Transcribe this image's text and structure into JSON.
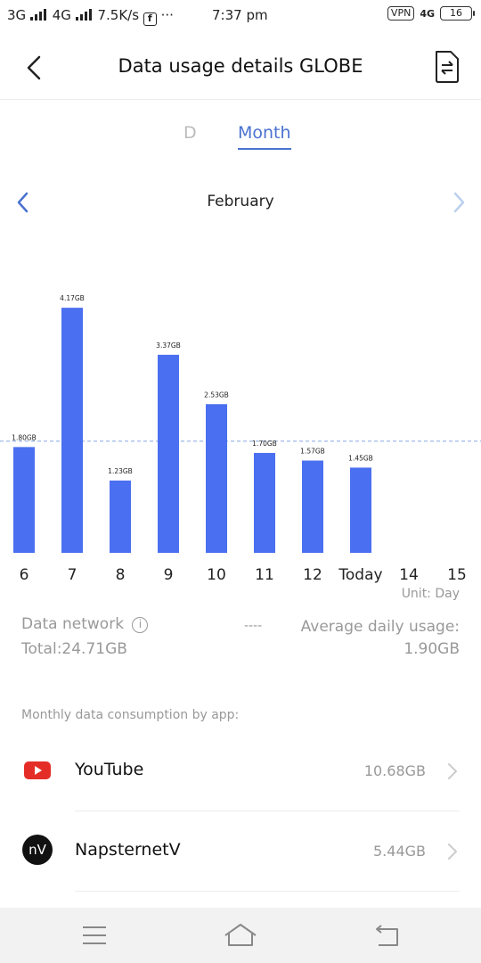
{
  "status_bar": {
    "left_text": "3G",
    "left_text2": "4G",
    "speed": "7.5K/s",
    "dots": "···",
    "time": "7:37 pm",
    "vpn": "VPN",
    "net": "4G",
    "battery": "16"
  },
  "header": {
    "title": "Data usage details GLOBE",
    "back_icon": "chevron-left-icon",
    "switch_icon": "sim-switch-icon"
  },
  "tabs": {
    "day": "D",
    "month": "Month",
    "selected": "Month"
  },
  "month_nav": {
    "label": "February"
  },
  "colors": {
    "accent": "#4a72d0",
    "bar": "#4a6ff0",
    "youtube": "#e52d27"
  },
  "chart_data": {
    "type": "bar",
    "categories": [
      "6",
      "7",
      "8",
      "9",
      "10",
      "11",
      "12",
      "Today",
      "14",
      "15"
    ],
    "values": [
      1.8,
      4.17,
      1.23,
      3.37,
      2.53,
      1.7,
      1.57,
      1.45,
      null,
      null
    ],
    "data_labels": [
      "1.80GB",
      "4.17GB",
      "1.23GB",
      "3.37GB",
      "2.53GB",
      "1.70GB",
      "1.57GB",
      "1.45GB",
      "",
      ""
    ],
    "average": 1.9,
    "ylim": [
      0,
      4.4
    ],
    "grid": false
  },
  "summary": {
    "unit": "Unit: Day",
    "network_label": "Data network",
    "total": "Total:24.71GB",
    "dashes": "----",
    "average_label": "Average daily usage:",
    "average_value": "1.90GB"
  },
  "apps_section": {
    "title": "Monthly data consumption by app:",
    "apps": [
      {
        "name": "YouTube",
        "usage": "10.68GB",
        "icon": "youtube-icon"
      },
      {
        "name": "NapsternetV",
        "usage": "5.44GB",
        "icon": "napsternetv-icon",
        "icon_text": "nV"
      }
    ]
  },
  "nav_bar": {
    "menu_icon": "menu-icon",
    "home_icon": "home-icon",
    "back_icon": "back-icon"
  }
}
